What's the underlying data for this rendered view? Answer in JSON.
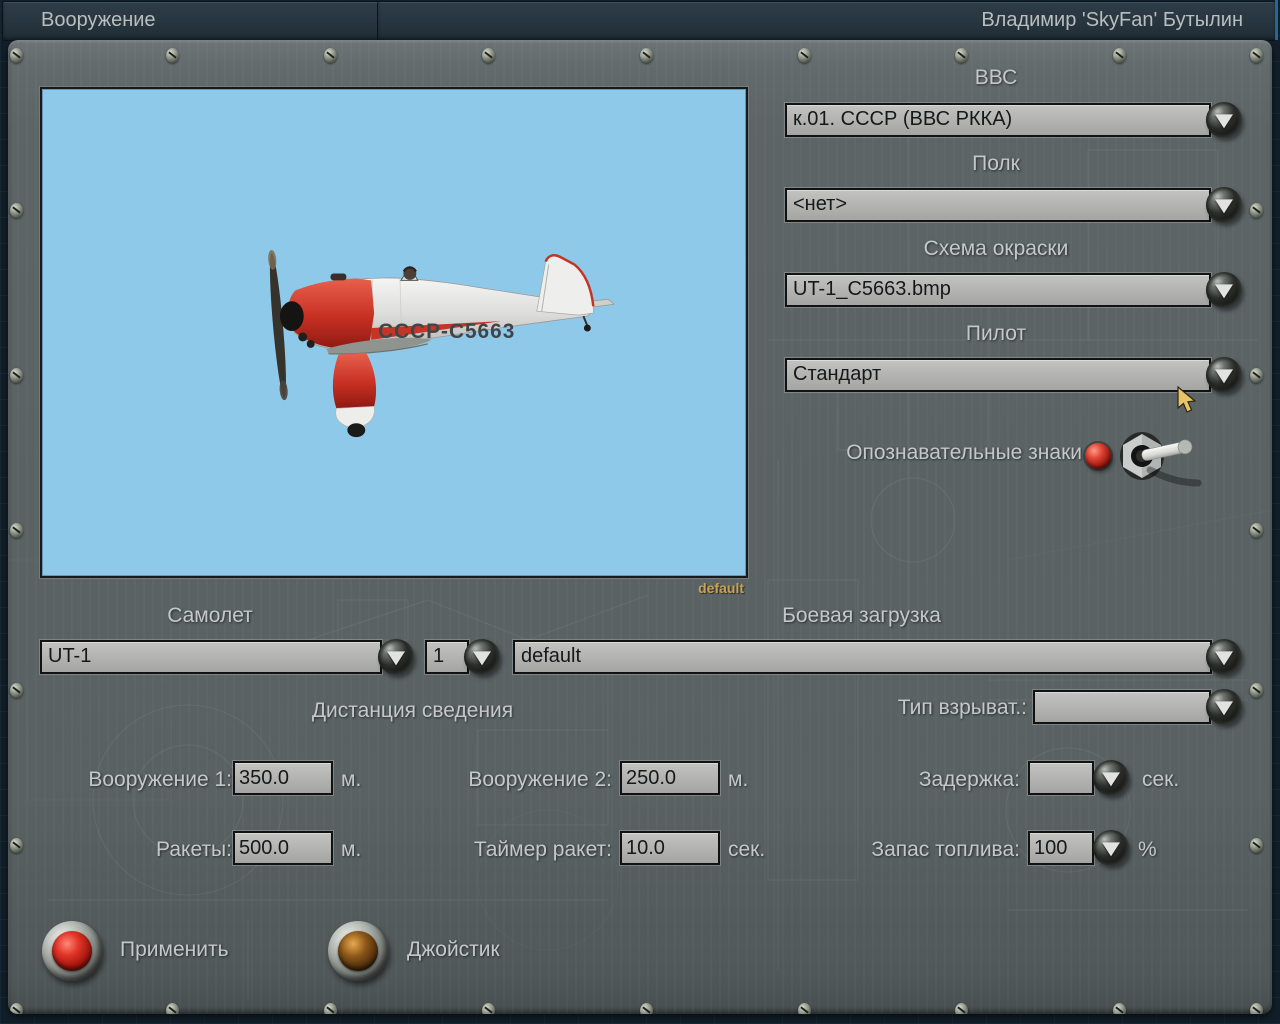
{
  "window": {
    "tab_label": "Вооружение",
    "player_name": "Владимир 'SkyFan' Бутылин"
  },
  "preview": {
    "registration": "СССР-С5663",
    "caption": "default"
  },
  "side_panel": {
    "airforce": {
      "label": "ВВС",
      "value": "к.01. СССР (ВВС РККА)"
    },
    "regiment": {
      "label": "Полк",
      "value": "<нет>"
    },
    "skin": {
      "label": "Схема окраски",
      "value": "UT-1_C5663.bmp"
    },
    "pilot": {
      "label": "Пилот",
      "value": "Стандарт"
    },
    "markings": {
      "label": "Опознавательные знаки"
    }
  },
  "aircraft_row": {
    "label": "Самолет",
    "value": "UT-1",
    "count": "1",
    "loadout_label": "Боевая загрузка",
    "loadout_value": "default"
  },
  "convergence": {
    "title": "Дистанция сведения"
  },
  "fuze": {
    "label": "Тип взрыват.:",
    "value": ""
  },
  "fields": {
    "weapon1": {
      "label": "Вооружение 1:",
      "value": "350.0",
      "unit": "м."
    },
    "weapon2": {
      "label": "Вооружение 2:",
      "value": "250.0",
      "unit": "м."
    },
    "delay": {
      "label": "Задержка:",
      "value": "",
      "unit": "сек."
    },
    "rockets": {
      "label": "Ракеты:",
      "value": "500.0",
      "unit": "м."
    },
    "rocket_timer": {
      "label": "Таймер ракет:",
      "value": "10.0",
      "unit": "сек."
    },
    "fuel": {
      "label": "Запас топлива:",
      "value": "100",
      "unit": "%"
    }
  },
  "buttons": {
    "apply": "Применить",
    "joystick": "Джойстик"
  },
  "colors": {
    "sky": "#8fc9ea",
    "panel": "#5c6466",
    "field_bg": "#b3b3b1",
    "caption_gold": "#c9a24f",
    "lamp_red": "#d0281c",
    "apply_red": "#d22a1c",
    "joystick_amber": "#7a4c16"
  }
}
